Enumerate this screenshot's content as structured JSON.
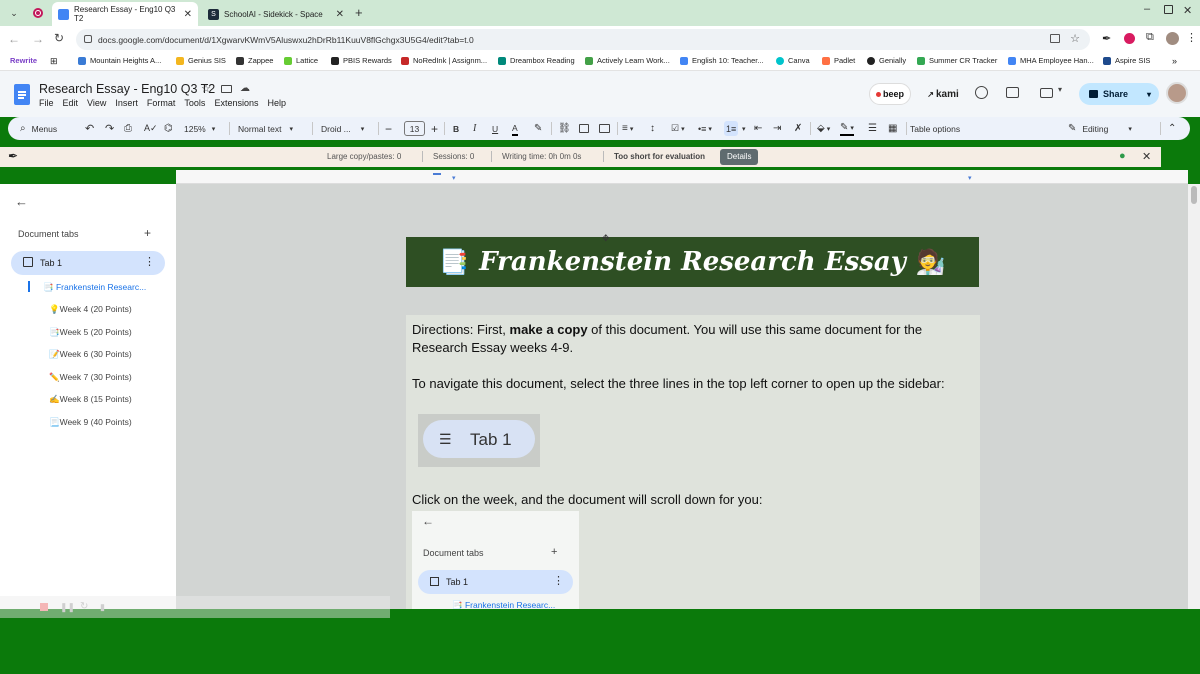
{
  "browser": {
    "tabs": [
      {
        "title": "Research Essay - Eng10 Q3 T2",
        "active": true
      },
      {
        "title": "SchoolAI - Sidekick - Space",
        "active": false
      }
    ],
    "url": "docs.google.com/document/d/1XgwarvKWmV5Aluswxu2hDrRb11KuuV8flGchgx3U5G4/edit?tab=t.0",
    "bookmarks": [
      "Rewrite",
      "Mountain Heights A...",
      "Genius SIS",
      "Zappee",
      "Lattice",
      "PBIS Rewards",
      "NoRedInk | Assignm...",
      "Dreambox Reading",
      "Actively Learn Work...",
      "English 10: Teacher...",
      "Canva",
      "Padlet",
      "Genially",
      "Summer CR Tracker",
      "MHA Employee Han...",
      "Aspire SIS"
    ]
  },
  "docs": {
    "title": "Research Essay - Eng10 Q3 T2",
    "menus": [
      "File",
      "Edit",
      "View",
      "Insert",
      "Format",
      "Tools",
      "Extensions",
      "Help"
    ],
    "beep": "beep",
    "kami": "kami",
    "share": "Share"
  },
  "toolbar": {
    "menus": "Menus",
    "zoom": "125%",
    "style": "Normal text",
    "font": "Droid ...",
    "font_size": "13",
    "table_options": "Table options",
    "mode": "Editing"
  },
  "extension": {
    "copy_pastes": "Large copy/pastes: 0",
    "sessions": "Sessions: 0",
    "writing_time": "Writing time: 0h 0m 0s",
    "status": "Too short for evaluation",
    "details": "Details"
  },
  "sidebar": {
    "heading": "Document tabs",
    "tab": "Tab 1",
    "items": [
      "📑 Frankenstein Researc...",
      "💡Week 4 (20 Points)",
      "📑Week 5 (20 Points)",
      "📝Week 6 (30 Points)",
      "✏️Week 7 (30 Points)",
      "✍️Week 8 (15 Points)",
      "📃Week 9 (40 Points)"
    ]
  },
  "document": {
    "banner_title": "Frankenstein Research Essay",
    "banner_icon_left": "📑",
    "banner_icon_right": "🧑‍🔬",
    "directions_prefix": "Directions: First, ",
    "directions_bold": "make a copy",
    "directions_suffix": " of this document. You will use this same document for the Research Essay weeks 4-9.",
    "navigate": "To navigate this document, select the three lines in the top left corner to open up the sidebar:",
    "tab_image_label": "Tab 1",
    "click_week": "Click on the week, and the document will scroll down for you:",
    "mini_heading": "Document tabs",
    "mini_tab": "Tab 1",
    "mini_item": "📑 Frankenstein Researc..."
  }
}
